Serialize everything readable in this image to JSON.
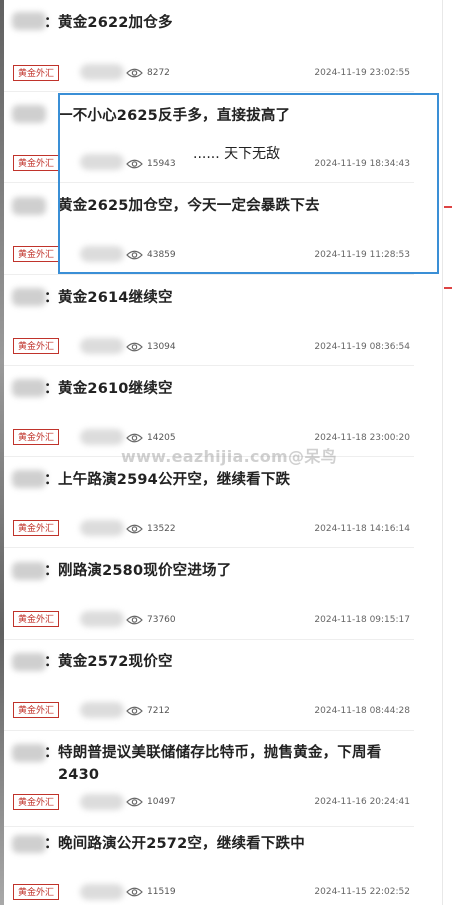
{
  "posts": [
    {
      "title": "黄金2622加仓多",
      "tag": "黄金外汇",
      "views": "8272",
      "time": "2024-11-19 23:02:55",
      "colon": "："
    },
    {
      "title": "一不小心2625反手多，直接拔高了",
      "tag": "黄金外汇",
      "views": "15943",
      "time": "2024-11-19 18:34:43",
      "colon": ""
    },
    {
      "title": "黄金2625加仓空，今天一定会暴跌下去",
      "tag": "黄金外汇",
      "views": "43859",
      "time": "2024-11-19 11:28:53",
      "colon": ""
    },
    {
      "title": "黄金2614继续空",
      "tag": "黄金外汇",
      "views": "13094",
      "time": "2024-11-19 08:36:54",
      "colon": "："
    },
    {
      "title": "黄金2610继续空",
      "tag": "黄金外汇",
      "views": "14205",
      "time": "2024-11-18 23:00:20",
      "colon": "："
    },
    {
      "title": "上午路演2594公开空，继续看下跌",
      "tag": "黄金外汇",
      "views": "13522",
      "time": "2024-11-18 14:16:14",
      "colon": "："
    },
    {
      "title": "刚路演2580现价空进场了",
      "tag": "黄金外汇",
      "views": "73760",
      "time": "2024-11-18 09:15:17",
      "colon": "："
    },
    {
      "title": "黄金2572现价空",
      "tag": "黄金外汇",
      "views": "7212",
      "time": "2024-11-18 08:44:28",
      "colon": "："
    },
    {
      "title": "特朗普提议美联储储存比特币，抛售黄金，下周看2430",
      "tag": "黄金外汇",
      "views": "10497",
      "time": "2024-11-16 20:24:41",
      "colon": "："
    },
    {
      "title": "晚间路演公开2572空，继续看下跌中",
      "tag": "黄金外汇",
      "views": "11519",
      "time": "2024-11-15 22:02:52",
      "colon": "："
    }
  ],
  "annotation": {
    "note": "...... 天下无敌"
  },
  "watermark": "www.eazhijia.com@呆鸟",
  "colors": {
    "tag_red": "#c0332b",
    "highlight_blue": "#3a8fd6"
  }
}
